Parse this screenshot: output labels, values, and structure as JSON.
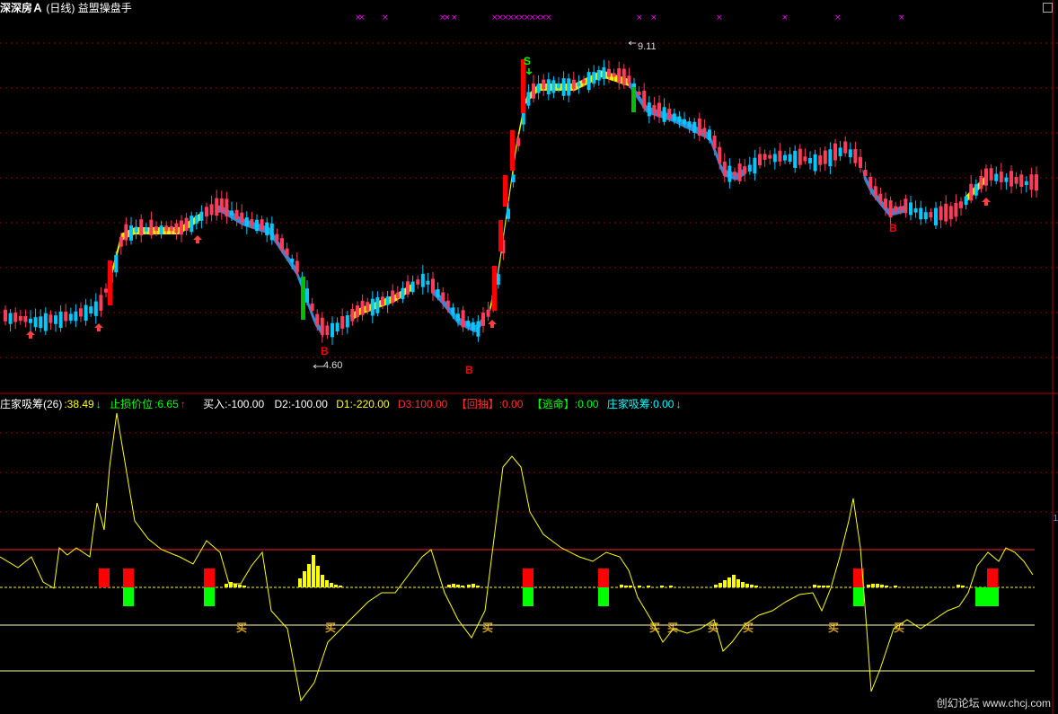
{
  "header": {
    "stock_name": "深深房Ａ",
    "period": "(日线)",
    "indicator_name": "益盟操盘手"
  },
  "price_annotations": {
    "high": "9.11",
    "low": "4.60"
  },
  "signals": {
    "sell": "S",
    "buy": "B",
    "buy_bottom": "买"
  },
  "indicator_bar": {
    "name": "庄家吸筹(26)",
    "val1": ":38.49",
    "val1_arrow": "↓",
    "stop_loss_label": "止损价位",
    "stop_loss_value": ":6.65",
    "stop_loss_arrow": "↑",
    "buy": "买入:-100.00",
    "d2": "D2:-100.00",
    "d1": "D1:-220.00",
    "d3": "D3:100.00",
    "huichou": "【回抽】:0.00",
    "taoming": "【逃命】:0.00",
    "zhuangjia": "庄家吸筹:0.00",
    "zhuangjia_arrow": "↓"
  },
  "side_marker": "1",
  "watermark": "创幻论坛 www.chcj.com",
  "colors": {
    "up": "#ff3c5a",
    "down": "#00c8ff",
    "ribbon_up": "#ffff00",
    "ribbon_down": "#3a8de0",
    "buy_arrow": "#ff4040",
    "grid": "#8b0000",
    "magenta": "#ff00ff",
    "green": "#00ff00",
    "red": "#ff0000",
    "yellow": "#ffff00",
    "buy_text": "#d4a020"
  }
}
